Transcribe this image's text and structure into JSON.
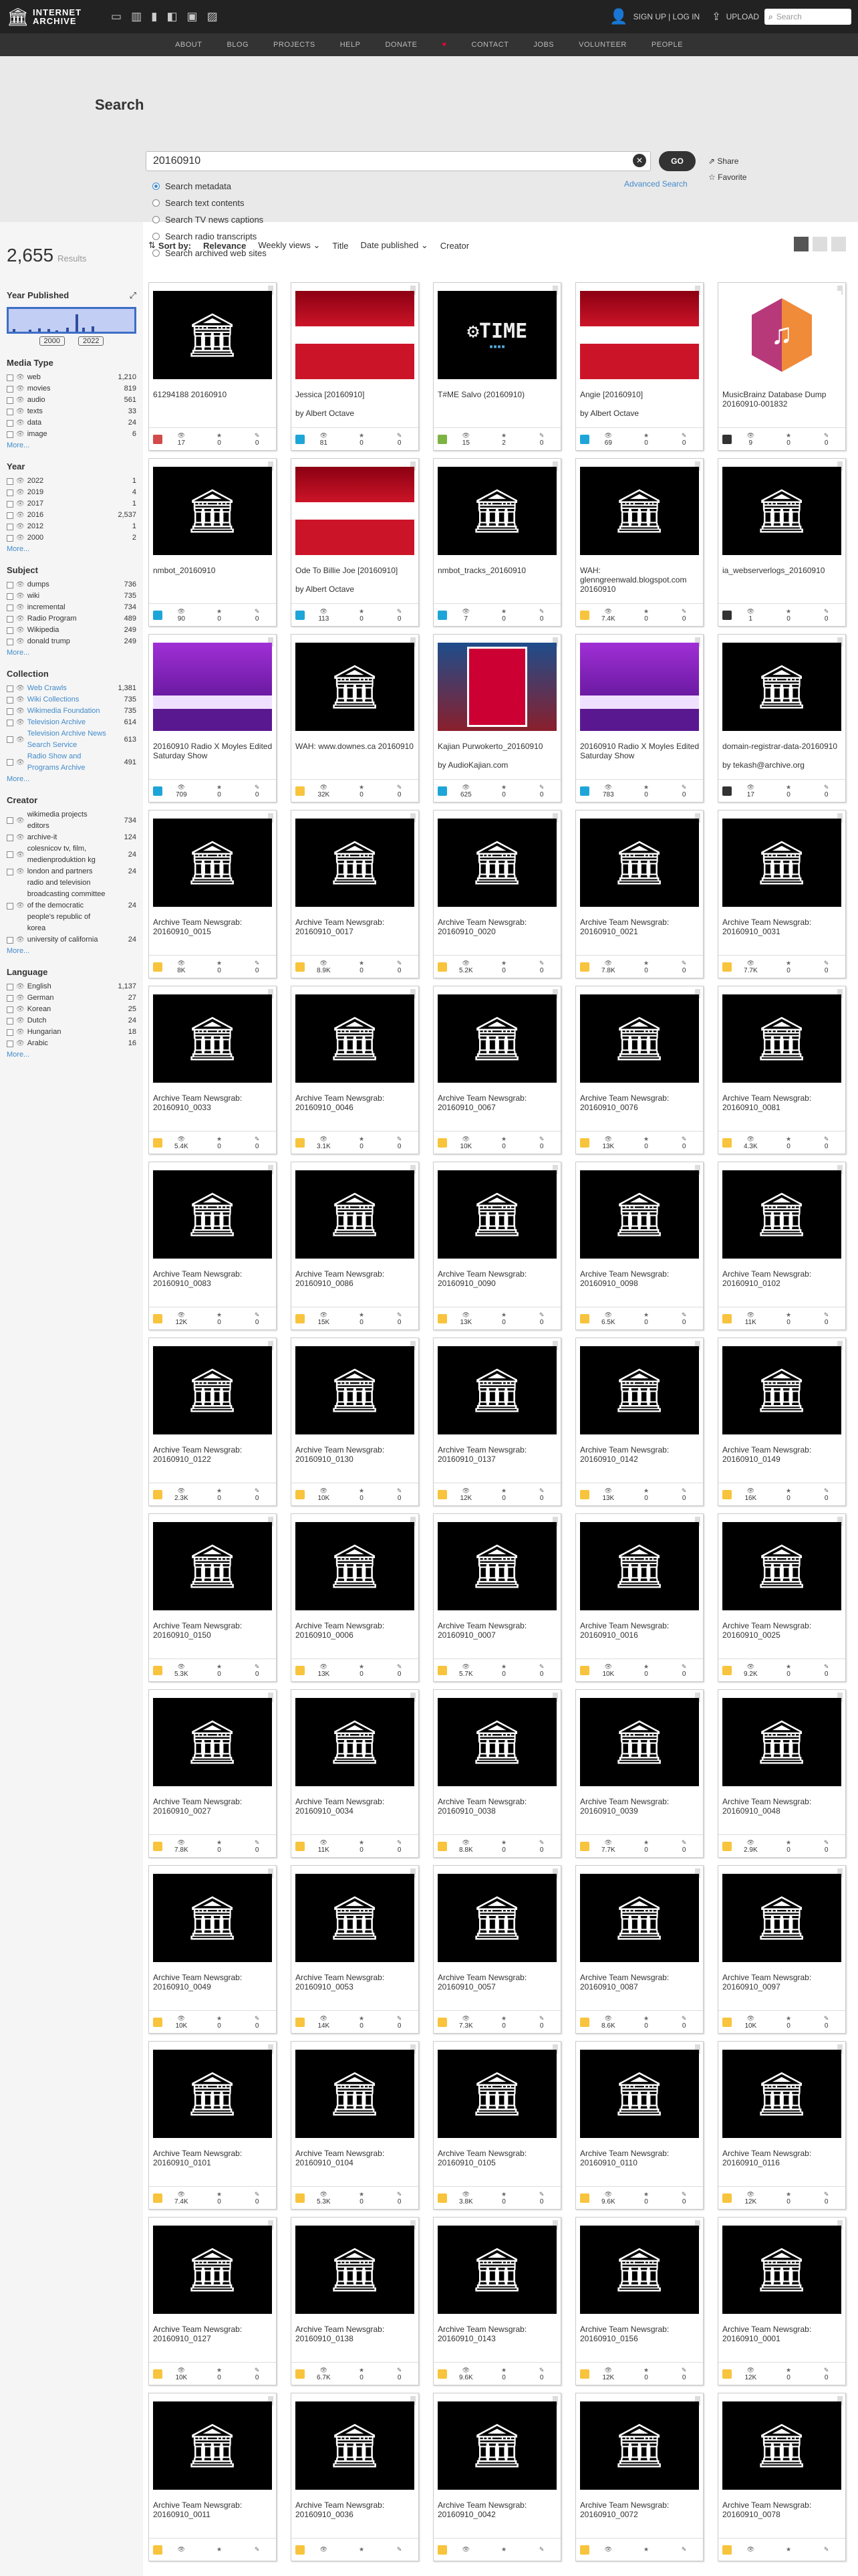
{
  "header": {
    "logo_line1": "INTERNET",
    "logo_line2": "ARCHIVE",
    "signup": "SIGN UP | LOG IN",
    "upload": "UPLOAD",
    "search_placeholder": "Search"
  },
  "nav": [
    "ABOUT",
    "BLOG",
    "PROJECTS",
    "HELP",
    "DONATE",
    "CONTACT",
    "JOBS",
    "VOLUNTEER",
    "PEOPLE"
  ],
  "search": {
    "label": "Search",
    "query": "20160910",
    "go": "GO",
    "share": "Share",
    "favorite": "Favorite",
    "advanced": "Advanced Search",
    "options": [
      "Search metadata",
      "Search text contents",
      "Search TV news captions",
      "Search radio transcripts",
      "Search archived web sites"
    ]
  },
  "results": {
    "count": "2,655",
    "label": "Results"
  },
  "year": {
    "title": "Year Published",
    "min": "2000",
    "max": "2022"
  },
  "facets": [
    {
      "title": "Media Type",
      "items": [
        [
          "web",
          "1,210"
        ],
        [
          "movies",
          "819"
        ],
        [
          "audio",
          "561"
        ],
        [
          "texts",
          "33"
        ],
        [
          "data",
          "24"
        ],
        [
          "image",
          "6"
        ]
      ],
      "more": "More..."
    },
    {
      "title": "Year",
      "items": [
        [
          "2022",
          "1"
        ],
        [
          "2019",
          "4"
        ],
        [
          "2017",
          "1"
        ],
        [
          "2016",
          "2,537"
        ],
        [
          "2012",
          "1"
        ],
        [
          "2000",
          "2"
        ]
      ],
      "more": "More..."
    },
    {
      "title": "Subject",
      "items": [
        [
          "dumps",
          "736"
        ],
        [
          "wiki",
          "735"
        ],
        [
          "incremental",
          "734"
        ],
        [
          "Radio Program",
          "489"
        ],
        [
          "Wikipedia",
          "249"
        ],
        [
          "donald trump",
          "249"
        ]
      ],
      "more": "More..."
    },
    {
      "title": "Collection",
      "link": true,
      "items": [
        [
          "Web Crawls",
          "1,381"
        ],
        [
          "Wiki Collections",
          "735"
        ],
        [
          "Wikimedia Foundation",
          "735"
        ],
        [
          "Television Archive",
          "614"
        ],
        [
          "Television Archive News Search Service",
          "613"
        ],
        [
          "Radio Show and Programs Archive",
          "491"
        ]
      ],
      "more": "More..."
    },
    {
      "title": "Creator",
      "items": [
        [
          "wikimedia projects editors",
          "734"
        ],
        [
          "archive-it",
          "124"
        ],
        [
          "colesnicov tv, film, medienproduktion kg",
          "24"
        ],
        [
          "london and partners",
          "24"
        ],
        [
          "radio and television broadcasting committee of the democratic people's republic of korea",
          "24"
        ],
        [
          "university of california",
          "24"
        ]
      ],
      "more": "More..."
    },
    {
      "title": "Language",
      "items": [
        [
          "English",
          "1,137"
        ],
        [
          "German",
          "27"
        ],
        [
          "Korean",
          "25"
        ],
        [
          "Dutch",
          "24"
        ],
        [
          "Hungarian",
          "18"
        ],
        [
          "Arabic",
          "16"
        ]
      ],
      "more": "More..."
    }
  ],
  "sort": {
    "label": "Sort by:",
    "options": [
      "Relevance",
      "Weekly views",
      "Title",
      "Date published",
      "Creator"
    ]
  },
  "colors": {
    "web": "#f8c43d",
    "audio": "#1ea5d8",
    "movies": "#d24b4b",
    "software": "#7cb342",
    "data": "#333333"
  },
  "cards": [
    {
      "title": "61294188 20160910",
      "thumb": "black",
      "type": "movies",
      "views": "17",
      "favs": "0",
      "reviews": "0"
    },
    {
      "title": "Jessica [20160910]",
      "by": "by Albert Octave",
      "thumb": "red",
      "type": "audio",
      "views": "81",
      "favs": "0",
      "reviews": "0"
    },
    {
      "title": "T#ME Salvo (20160910)",
      "thumb": "time",
      "type": "software",
      "views": "15",
      "favs": "2",
      "reviews": "0"
    },
    {
      "title": "Angie [20160910]",
      "by": "by Albert Octave",
      "thumb": "red",
      "type": "audio",
      "views": "69",
      "favs": "0",
      "reviews": "0"
    },
    {
      "title": "MusicBrainz Database Dump 20160910-001832",
      "thumb": "music",
      "type": "data",
      "views": "9",
      "favs": "0",
      "reviews": "0"
    },
    {
      "title": "nmbot_20160910",
      "thumb": "black",
      "type": "audio",
      "views": "90",
      "favs": "0",
      "reviews": "0"
    },
    {
      "title": "Ode To Billie Joe [20160910]",
      "by": "by Albert Octave",
      "thumb": "red",
      "type": "audio",
      "views": "113",
      "favs": "0",
      "reviews": "0"
    },
    {
      "title": "nmbot_tracks_20160910",
      "thumb": "black",
      "type": "audio",
      "views": "7",
      "favs": "0",
      "reviews": "0"
    },
    {
      "title": "WAH: glenngreenwald.blogspot.com 20160910",
      "thumb": "black",
      "type": "web",
      "views": "7.4K",
      "favs": "0",
      "reviews": "0"
    },
    {
      "title": "ia_webserverlogs_20160910",
      "thumb": "black",
      "type": "data",
      "views": "1",
      "favs": "0",
      "reviews": "0"
    },
    {
      "title": "20160910 Radio X Moyles Edited Saturday Show",
      "thumb": "purple",
      "type": "audio",
      "views": "709",
      "favs": "0",
      "reviews": "0"
    },
    {
      "title": "WAH: www.downes.ca 20160910",
      "thumb": "black",
      "type": "web",
      "views": "32K",
      "favs": "0",
      "reviews": "0"
    },
    {
      "title": "Kajian Purwokerto_20160910",
      "by": "by AudioKajian.com",
      "thumb": "poster",
      "type": "audio",
      "views": "625",
      "favs": "0",
      "reviews": "0"
    },
    {
      "title": "20160910 Radio X Moyles Edited Saturday Show",
      "thumb": "purple",
      "type": "audio",
      "views": "783",
      "favs": "0",
      "reviews": "0"
    },
    {
      "title": "domain-registrar-data-20160910",
      "by": "by tekash@archive.org",
      "thumb": "black",
      "type": "data",
      "views": "17",
      "favs": "0",
      "reviews": "0"
    },
    {
      "title": "Archive Team Newsgrab: 20160910_0015",
      "thumb": "black",
      "type": "web",
      "views": "8K",
      "favs": "0",
      "reviews": "0"
    },
    {
      "title": "Archive Team Newsgrab: 20160910_0017",
      "thumb": "black",
      "type": "web",
      "views": "8.9K",
      "favs": "0",
      "reviews": "0"
    },
    {
      "title": "Archive Team Newsgrab: 20160910_0020",
      "thumb": "black",
      "type": "web",
      "views": "5.2K",
      "favs": "0",
      "reviews": "0"
    },
    {
      "title": "Archive Team Newsgrab: 20160910_0021",
      "thumb": "black",
      "type": "web",
      "views": "7.8K",
      "favs": "0",
      "reviews": "0"
    },
    {
      "title": "Archive Team Newsgrab: 20160910_0031",
      "thumb": "black",
      "type": "web",
      "views": "7.7K",
      "favs": "0",
      "reviews": "0"
    },
    {
      "title": "Archive Team Newsgrab: 20160910_0033",
      "thumb": "black",
      "type": "web",
      "views": "5.4K",
      "favs": "0",
      "reviews": "0"
    },
    {
      "title": "Archive Team Newsgrab: 20160910_0046",
      "thumb": "black",
      "type": "web",
      "views": "3.1K",
      "favs": "0",
      "reviews": "0"
    },
    {
      "title": "Archive Team Newsgrab: 20160910_0067",
      "thumb": "black",
      "type": "web",
      "views": "10K",
      "favs": "0",
      "reviews": "0"
    },
    {
      "title": "Archive Team Newsgrab: 20160910_0076",
      "thumb": "black",
      "type": "web",
      "views": "13K",
      "favs": "0",
      "reviews": "0"
    },
    {
      "title": "Archive Team Newsgrab: 20160910_0081",
      "thumb": "black",
      "type": "web",
      "views": "4.3K",
      "favs": "0",
      "reviews": "0"
    },
    {
      "title": "Archive Team Newsgrab: 20160910_0083",
      "thumb": "black",
      "type": "web",
      "views": "12K",
      "favs": "0",
      "reviews": "0"
    },
    {
      "title": "Archive Team Newsgrab: 20160910_0086",
      "thumb": "black",
      "type": "web",
      "views": "15K",
      "favs": "0",
      "reviews": "0"
    },
    {
      "title": "Archive Team Newsgrab: 20160910_0090",
      "thumb": "black",
      "type": "web",
      "views": "13K",
      "favs": "0",
      "reviews": "0"
    },
    {
      "title": "Archive Team Newsgrab: 20160910_0098",
      "thumb": "black",
      "type": "web",
      "views": "6.5K",
      "favs": "0",
      "reviews": "0"
    },
    {
      "title": "Archive Team Newsgrab: 20160910_0102",
      "thumb": "black",
      "type": "web",
      "views": "11K",
      "favs": "0",
      "reviews": "0"
    },
    {
      "title": "Archive Team Newsgrab: 20160910_0122",
      "thumb": "black",
      "type": "web",
      "views": "2.3K",
      "favs": "0",
      "reviews": "0"
    },
    {
      "title": "Archive Team Newsgrab: 20160910_0130",
      "thumb": "black",
      "type": "web",
      "views": "10K",
      "favs": "0",
      "reviews": "0"
    },
    {
      "title": "Archive Team Newsgrab: 20160910_0137",
      "thumb": "black",
      "type": "web",
      "views": "12K",
      "favs": "0",
      "reviews": "0"
    },
    {
      "title": "Archive Team Newsgrab: 20160910_0142",
      "thumb": "black",
      "type": "web",
      "views": "13K",
      "favs": "0",
      "reviews": "0"
    },
    {
      "title": "Archive Team Newsgrab: 20160910_0149",
      "thumb": "black",
      "type": "web",
      "views": "16K",
      "favs": "0",
      "reviews": "0"
    },
    {
      "title": "Archive Team Newsgrab: 20160910_0150",
      "thumb": "black",
      "type": "web",
      "views": "5.3K",
      "favs": "0",
      "reviews": "0"
    },
    {
      "title": "Archive Team Newsgrab: 20160910_0006",
      "thumb": "black",
      "type": "web",
      "views": "13K",
      "favs": "0",
      "reviews": "0"
    },
    {
      "title": "Archive Team Newsgrab: 20160910_0007",
      "thumb": "black",
      "type": "web",
      "views": "5.7K",
      "favs": "0",
      "reviews": "0"
    },
    {
      "title": "Archive Team Newsgrab: 20160910_0016",
      "thumb": "black",
      "type": "web",
      "views": "10K",
      "favs": "0",
      "reviews": "0"
    },
    {
      "title": "Archive Team Newsgrab: 20160910_0025",
      "thumb": "black",
      "type": "web",
      "views": "9.2K",
      "favs": "0",
      "reviews": "0"
    },
    {
      "title": "Archive Team Newsgrab: 20160910_0027",
      "thumb": "black",
      "type": "web",
      "views": "7.8K",
      "favs": "0",
      "reviews": "0"
    },
    {
      "title": "Archive Team Newsgrab: 20160910_0034",
      "thumb": "black",
      "type": "web",
      "views": "11K",
      "favs": "0",
      "reviews": "0"
    },
    {
      "title": "Archive Team Newsgrab: 20160910_0038",
      "thumb": "black",
      "type": "web",
      "views": "8.8K",
      "favs": "0",
      "reviews": "0"
    },
    {
      "title": "Archive Team Newsgrab: 20160910_0039",
      "thumb": "black",
      "type": "web",
      "views": "7.7K",
      "favs": "0",
      "reviews": "0"
    },
    {
      "title": "Archive Team Newsgrab: 20160910_0048",
      "thumb": "black",
      "type": "web",
      "views": "2.9K",
      "favs": "0",
      "reviews": "0"
    },
    {
      "title": "Archive Team Newsgrab: 20160910_0049",
      "thumb": "black",
      "type": "web",
      "views": "10K",
      "favs": "0",
      "reviews": "0"
    },
    {
      "title": "Archive Team Newsgrab: 20160910_0053",
      "thumb": "black",
      "type": "web",
      "views": "14K",
      "favs": "0",
      "reviews": "0"
    },
    {
      "title": "Archive Team Newsgrab: 20160910_0057",
      "thumb": "black",
      "type": "web",
      "views": "7.3K",
      "favs": "0",
      "reviews": "0"
    },
    {
      "title": "Archive Team Newsgrab: 20160910_0087",
      "thumb": "black",
      "type": "web",
      "views": "8.6K",
      "favs": "0",
      "reviews": "0"
    },
    {
      "title": "Archive Team Newsgrab: 20160910_0097",
      "thumb": "black",
      "type": "web",
      "views": "10K",
      "favs": "0",
      "reviews": "0"
    },
    {
      "title": "Archive Team Newsgrab: 20160910_0101",
      "thumb": "black",
      "type": "web",
      "views": "7.4K",
      "favs": "0",
      "reviews": "0"
    },
    {
      "title": "Archive Team Newsgrab: 20160910_0104",
      "thumb": "black",
      "type": "web",
      "views": "5.3K",
      "favs": "0",
      "reviews": "0"
    },
    {
      "title": "Archive Team Newsgrab: 20160910_0105",
      "thumb": "black",
      "type": "web",
      "views": "3.8K",
      "favs": "0",
      "reviews": "0"
    },
    {
      "title": "Archive Team Newsgrab: 20160910_0110",
      "thumb": "black",
      "type": "web",
      "views": "9.6K",
      "favs": "0",
      "reviews": "0"
    },
    {
      "title": "Archive Team Newsgrab: 20160910_0116",
      "thumb": "black",
      "type": "web",
      "views": "12K",
      "favs": "0",
      "reviews": "0"
    },
    {
      "title": "Archive Team Newsgrab: 20160910_0127",
      "thumb": "black",
      "type": "web",
      "views": "10K",
      "favs": "0",
      "reviews": "0"
    },
    {
      "title": "Archive Team Newsgrab: 20160910_0138",
      "thumb": "black",
      "type": "web",
      "views": "6.7K",
      "favs": "0",
      "reviews": "0"
    },
    {
      "title": "Archive Team Newsgrab: 20160910_0143",
      "thumb": "black",
      "type": "web",
      "views": "9.6K",
      "favs": "0",
      "reviews": "0"
    },
    {
      "title": "Archive Team Newsgrab: 20160910_0156",
      "thumb": "black",
      "type": "web",
      "views": "12K",
      "favs": "0",
      "reviews": "0"
    },
    {
      "title": "Archive Team Newsgrab: 20160910_0001",
      "thumb": "black",
      "type": "web",
      "views": "12K",
      "favs": "0",
      "reviews": "0"
    },
    {
      "title": "Archive Team Newsgrab: 20160910_0011",
      "thumb": "black",
      "type": "web",
      "views": "",
      "favs": "",
      "reviews": ""
    },
    {
      "title": "Archive Team Newsgrab: 20160910_0036",
      "thumb": "black",
      "type": "web",
      "views": "",
      "favs": "",
      "reviews": ""
    },
    {
      "title": "Archive Team Newsgrab: 20160910_0042",
      "thumb": "black",
      "type": "web",
      "views": "",
      "favs": "",
      "reviews": ""
    },
    {
      "title": "Archive Team Newsgrab: 20160910_0072",
      "thumb": "black",
      "type": "web",
      "views": "",
      "favs": "",
      "reviews": ""
    },
    {
      "title": "Archive Team Newsgrab: 20160910_0078",
      "thumb": "black",
      "type": "web",
      "views": "",
      "favs": "",
      "reviews": ""
    }
  ]
}
